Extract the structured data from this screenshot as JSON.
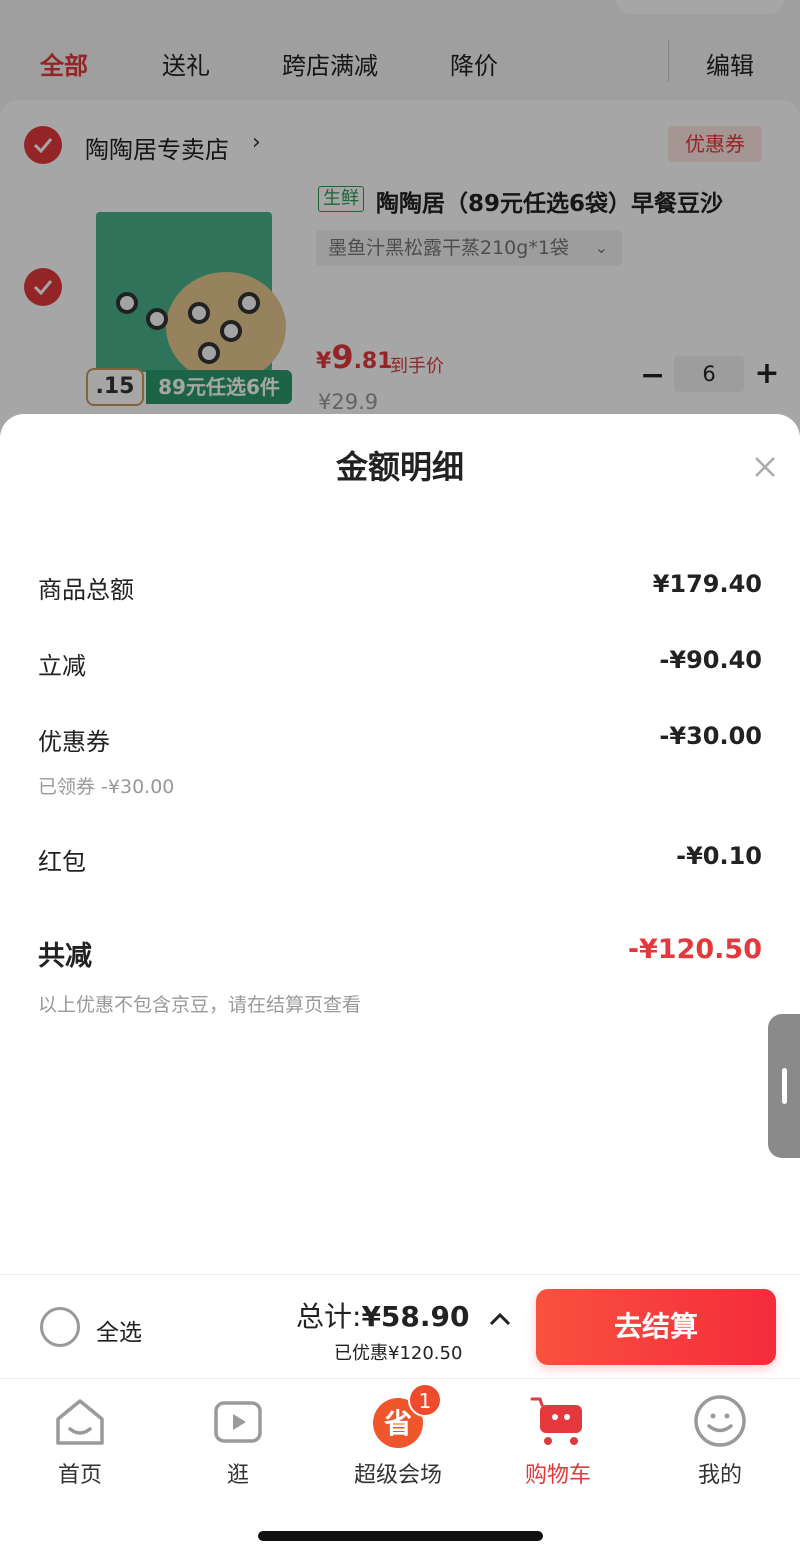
{
  "tabs": [
    {
      "label": "全部",
      "active": true
    },
    {
      "label": "送礼",
      "active": false
    },
    {
      "label": "跨店满减",
      "active": false
    },
    {
      "label": "降价",
      "active": false
    }
  ],
  "edit_label": "编辑",
  "store": {
    "name": "陶陶居专卖店",
    "arrow": "›",
    "coupon_label": "优惠券"
  },
  "product": {
    "tag": "生鲜",
    "title": "陶陶居（89元任选6袋）早餐豆沙",
    "spec": "墨鱼汁黑松露干蒸210g*1袋",
    "spec_chevron": "⌄",
    "promo_left": ".15",
    "promo_right": "89元任选6件",
    "price_symbol": "¥",
    "price_int": "9",
    "price_dec": ".81",
    "price_label": "到手价",
    "price_old": "¥29.9",
    "quantity": "6",
    "minus": "−",
    "plus": "+"
  },
  "sheet": {
    "title": "金额明细",
    "rows": [
      {
        "label": "商品总额",
        "value": "¥179.40"
      },
      {
        "label": "立减",
        "value": "-¥90.40"
      },
      {
        "label": "优惠券",
        "value": "-¥30.00"
      },
      {
        "label": "红包",
        "value": "-¥0.10"
      }
    ],
    "coupon_note": "已领券 -¥30.00",
    "total": {
      "label": "共减",
      "value": "-¥120.50"
    },
    "disclaimer": "以上优惠不包含京豆，请在结算页查看"
  },
  "checkout": {
    "select_all": "全选",
    "total_prefix": "总计:",
    "total_amount": "¥58.90",
    "saved": "已优惠¥120.50",
    "button": "去结算"
  },
  "nav": [
    {
      "label": "首页",
      "icon": "home-icon"
    },
    {
      "label": "逛",
      "icon": "video-icon"
    },
    {
      "label": "超级会场",
      "icon": "super-venue-icon",
      "badge": "1",
      "badge_glyph": "省"
    },
    {
      "label": "购物车",
      "icon": "cart-icon",
      "active": true
    },
    {
      "label": "我的",
      "icon": "profile-icon"
    }
  ],
  "colors": {
    "accent": "#e4393c",
    "fresh": "#2f9b58"
  }
}
